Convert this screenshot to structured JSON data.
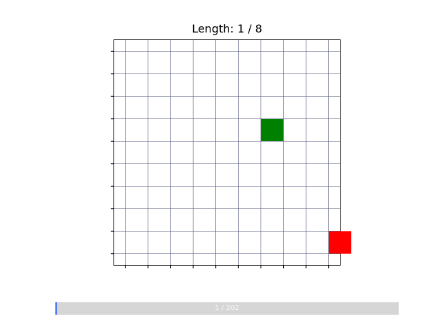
{
  "game": {
    "title": "Length: 1 / 8",
    "grid": {
      "cols": 10,
      "rows": 10
    },
    "snake": {
      "color": "#008000",
      "cells": [
        {
          "col": 6,
          "row": 3
        }
      ]
    },
    "food": {
      "color": "#ff0000",
      "cell": {
        "col": 9,
        "row": 8
      }
    }
  },
  "playback": {
    "frame_label": "1 / 202",
    "frame": 1,
    "total_frames": 202,
    "progress_color": "#3b6ff0",
    "track_color": "#d6d6d6"
  }
}
